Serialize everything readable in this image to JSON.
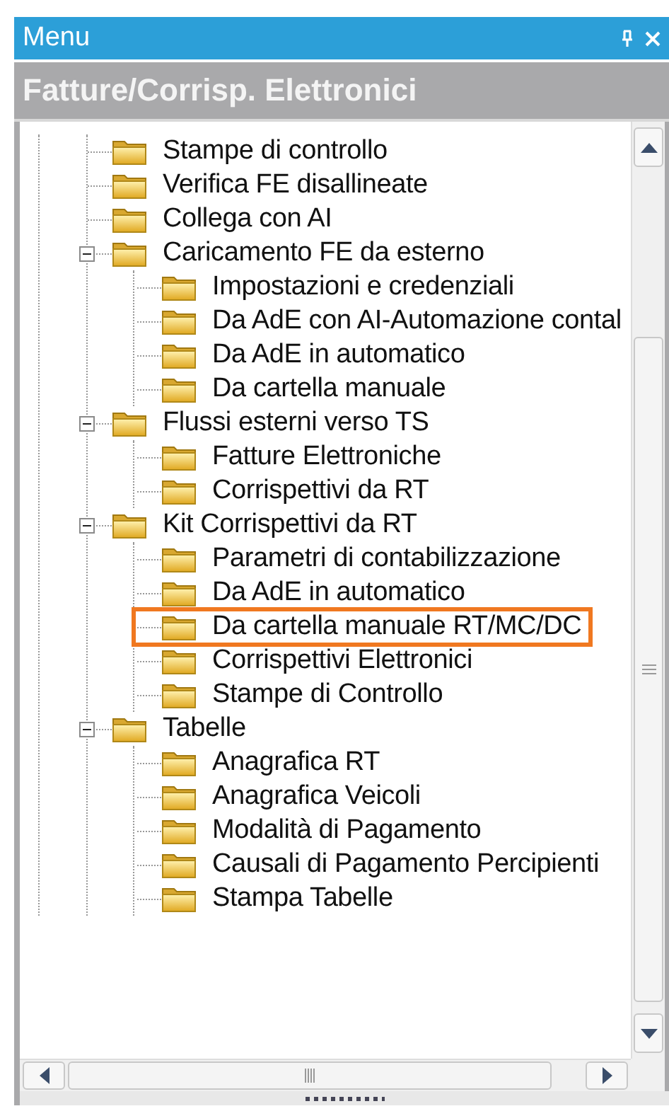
{
  "panel": {
    "title": "Menu",
    "section_title": "Fatture/Corrisp. Elettronici"
  },
  "tree": [
    {
      "label": "Stampe di controllo",
      "highlighted": false
    },
    {
      "label": "Verifica FE disallineate",
      "highlighted": false
    },
    {
      "label": "Collega con AI",
      "highlighted": false
    },
    {
      "label": "Caricamento FE da esterno",
      "highlighted": false,
      "expanded": true,
      "children": [
        {
          "label": "Impostazioni e credenziali",
          "highlighted": false
        },
        {
          "label": "Da AdE con AI-Automazione contal",
          "highlighted": false
        },
        {
          "label": "Da AdE in automatico",
          "highlighted": false
        },
        {
          "label": "Da cartella manuale",
          "highlighted": false
        }
      ]
    },
    {
      "label": "Flussi esterni verso TS",
      "highlighted": false,
      "expanded": true,
      "children": [
        {
          "label": "Fatture Elettroniche",
          "highlighted": false
        },
        {
          "label": "Corrispettivi da RT",
          "highlighted": false
        }
      ]
    },
    {
      "label": "Kit Corrispettivi da RT",
      "highlighted": false,
      "expanded": true,
      "children": [
        {
          "label": "Parametri di contabilizzazione",
          "highlighted": false
        },
        {
          "label": "Da AdE in automatico",
          "highlighted": false
        },
        {
          "label": "Da cartella manuale RT/MC/DC",
          "highlighted": true
        },
        {
          "label": "Corrispettivi Elettronici",
          "highlighted": false
        },
        {
          "label": "Stampe di Controllo",
          "highlighted": false
        }
      ]
    },
    {
      "label": "Tabelle",
      "highlighted": false,
      "expanded": true,
      "children": [
        {
          "label": "Anagrafica RT",
          "highlighted": false
        },
        {
          "label": "Anagrafica Veicoli",
          "highlighted": false
        },
        {
          "label": "Modalità di Pagamento",
          "highlighted": false
        },
        {
          "label": "Causali di Pagamento Percipienti",
          "highlighted": false
        },
        {
          "label": "Stampa Tabelle",
          "highlighted": false
        }
      ]
    }
  ]
}
